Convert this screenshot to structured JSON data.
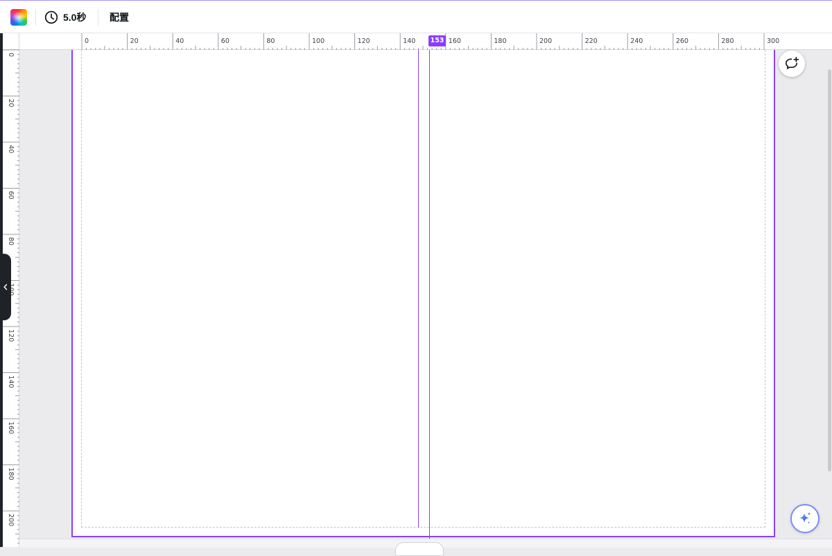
{
  "toolbar": {
    "duration_label": "5.0秒",
    "arrange_label": "配置",
    "icons": {
      "color": "rainbow-color-icon",
      "duration": "clock-icon"
    }
  },
  "ruler": {
    "horizontal_ticks": [
      "0",
      "20",
      "40",
      "60",
      "80",
      "100",
      "120",
      "140",
      "160",
      "180",
      "200",
      "220",
      "240",
      "260",
      "280",
      "300"
    ],
    "vertical_ticks": [
      "0",
      "20",
      "40",
      "60",
      "80",
      "100",
      "120",
      "140",
      "160",
      "180",
      "200"
    ],
    "guide_position_label": "153"
  },
  "colors": {
    "accent": "#8b3dff",
    "canvas_bg": "#ebebee",
    "page_bg": "#ffffff"
  },
  "icons": {
    "panel_handle": "chevron-left-icon",
    "comment": "comment-plus-icon",
    "assistant": "sparkle-icon"
  }
}
